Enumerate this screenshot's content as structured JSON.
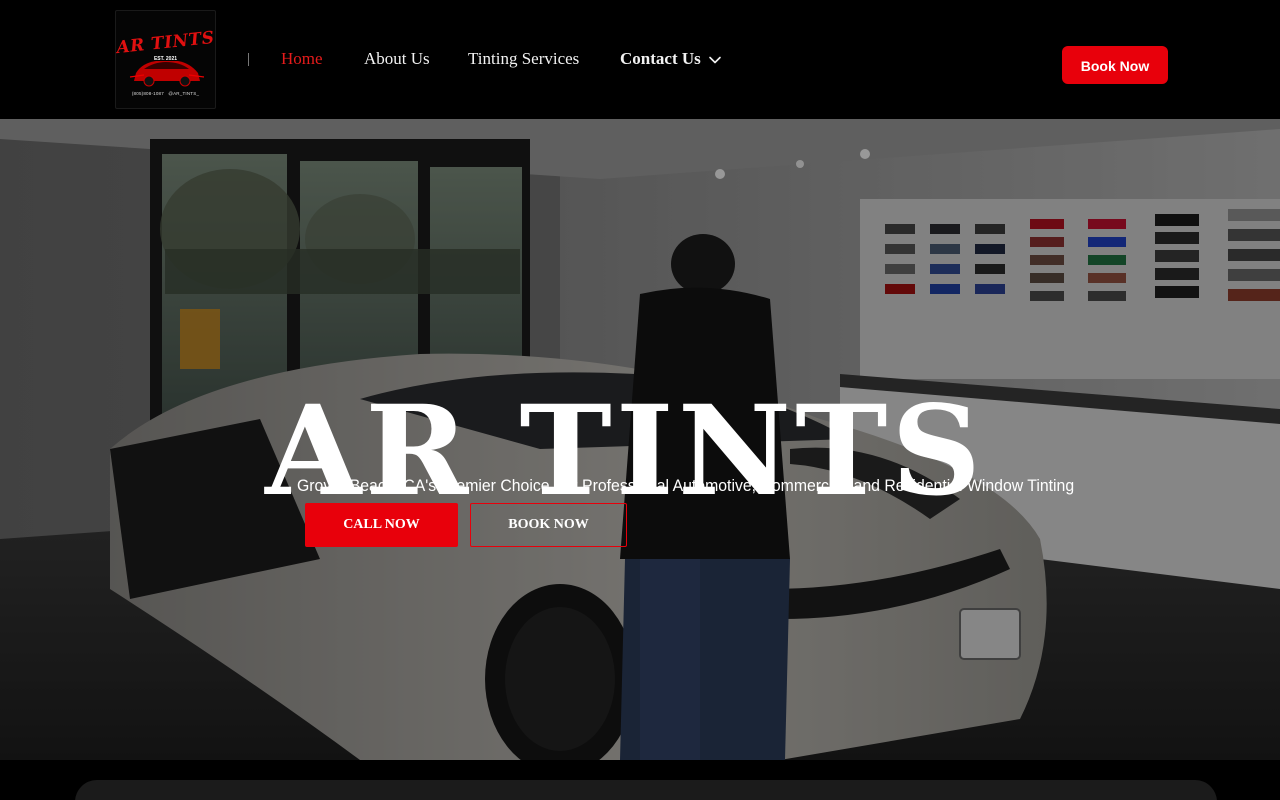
{
  "header": {
    "logo": {
      "title": "AR TINTS",
      "established": "EST. 2021",
      "phone": "(805)808-1087",
      "handle": "@AR_TINTS_"
    },
    "nav": [
      {
        "label": "Home",
        "active": true
      },
      {
        "label": "About Us",
        "active": false
      },
      {
        "label": "Tinting Services",
        "active": false
      },
      {
        "label": "Contact Us",
        "active": false,
        "has_dropdown": true
      }
    ],
    "cta_label": "Book Now"
  },
  "hero": {
    "title": "AR TINTS",
    "subtitle": "Grover Beach, CA's Premier Choice For Professional Automotive, Commercial, and Residential Window Tinting",
    "primary_button": "CALL NOW",
    "secondary_button": "BOOK NOW",
    "background_image": "technician-tinting-sports-car-in-showroom"
  },
  "colors": {
    "accent": "#e8000b",
    "nav_active": "#e51b1b",
    "header_bg": "#000000",
    "text": "#ffffff"
  },
  "icons": {
    "dropdown": "chevron-down-icon"
  }
}
